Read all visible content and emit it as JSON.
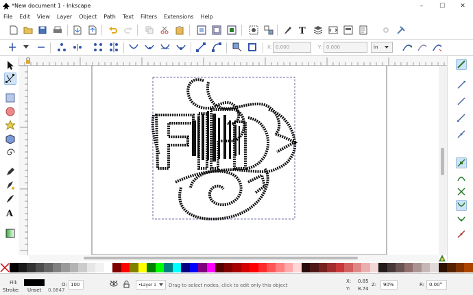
{
  "window": {
    "title": "*New document 1 - Inkscape",
    "minimize": "–",
    "maximize": "☐",
    "close": "✕"
  },
  "menu": [
    "File",
    "Edit",
    "View",
    "Layer",
    "Object",
    "Path",
    "Text",
    "Filters",
    "Extensions",
    "Help"
  ],
  "controls": {
    "x_label": "X:",
    "x_value": "0.000",
    "y_label": "Y:",
    "y_value": "0.000",
    "unit": "in"
  },
  "status": {
    "fill_label": "Fill:",
    "stroke_label": "Stroke:",
    "stroke_value": "Unset",
    "stroke_width": "0.0847",
    "opacity_label": "O:",
    "opacity_value": "100",
    "layer": "•Layer 1",
    "message": "Drag to select nodes, click to edit only this object",
    "x_label": "X:",
    "x_value": "0.85",
    "y_label": "Y:",
    "y_value": "8.74",
    "zoom_label": "Z:",
    "zoom_value": "90%",
    "rotate_label": "R:",
    "rotate_value": "0.00°"
  },
  "palette": [
    "#000000",
    "#1a1a1a",
    "#333333",
    "#4d4d4d",
    "#666666",
    "#808080",
    "#999999",
    "#b3b3b3",
    "#cccccc",
    "#e6e6e6",
    "#f2f2f2",
    "#ffffff",
    "#800000",
    "#ff0000",
    "#808000",
    "#ffff00",
    "#008000",
    "#00ff00",
    "#008080",
    "#00ffff",
    "#000080",
    "#0000ff",
    "#800080",
    "#ff00ff",
    "#550000",
    "#800000",
    "#aa0000",
    "#d40000",
    "#ff0000",
    "#ff2a2a",
    "#ff5555",
    "#ff8080",
    "#ffaaaa",
    "#ffd5d5",
    "#280b0b",
    "#501616",
    "#782121",
    "#a02c2c",
    "#c83737",
    "#d35f5f",
    "#de8787",
    "#e9afaf",
    "#f4d7d7",
    "#241c1c",
    "#483737",
    "#6c5353",
    "#916f6f",
    "#ac9393",
    "#c8b7b7",
    "#e3dbdb",
    "#2b1100",
    "#552200",
    "#803300",
    "#aa4400"
  ]
}
